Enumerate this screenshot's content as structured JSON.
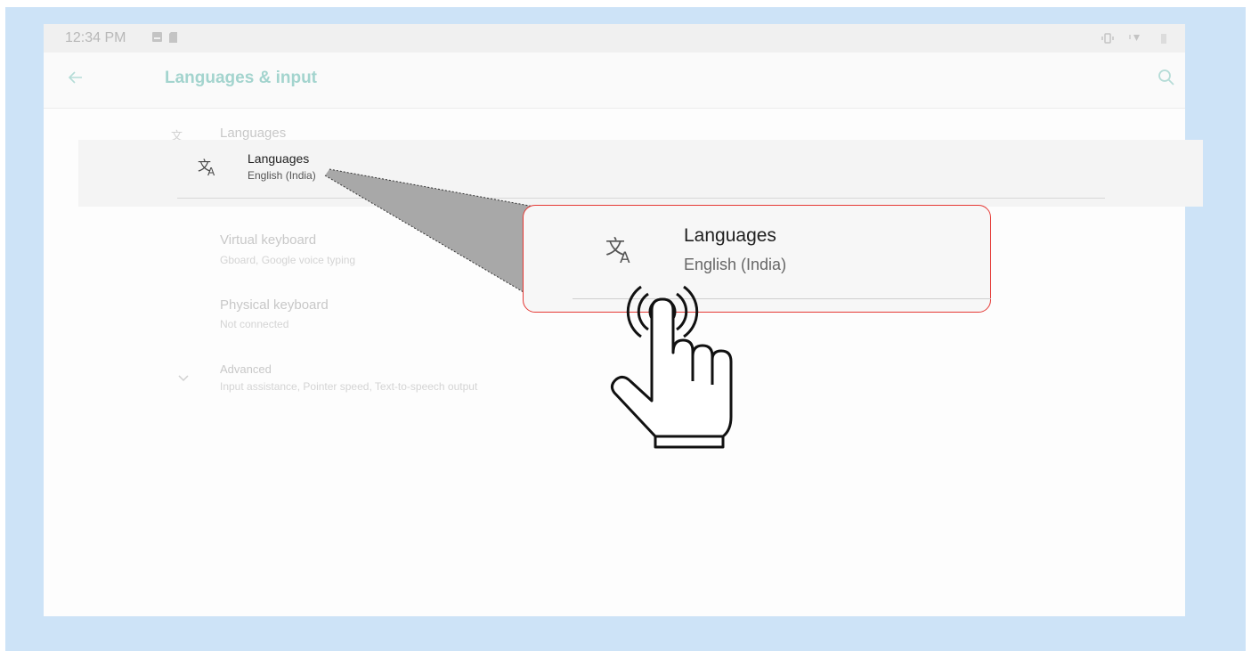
{
  "status_bar": {
    "time": "12:34 PM"
  },
  "toolbar": {
    "title": "Languages & input"
  },
  "list": {
    "languages_header": "Languages",
    "virtual_keyboard": {
      "title": "Virtual keyboard",
      "subtitle": "Gboard, Google voice typing"
    },
    "physical_keyboard": {
      "title": "Physical keyboard",
      "subtitle": "Not connected"
    },
    "advanced": {
      "title": "Advanced",
      "subtitle": "Input assistance, Pointer speed, Text-to-speech output"
    }
  },
  "highlight": {
    "title": "Languages",
    "subtitle": "English (India)"
  },
  "zoom": {
    "title": "Languages",
    "subtitle": "English (India)"
  },
  "colors": {
    "accent": "#a3d4ce",
    "callout_border": "#e53935",
    "frame": "#cde3f7"
  },
  "icons": {
    "translate": "translate-icon",
    "back": "arrow-back-icon",
    "search": "search-icon",
    "tap": "tap-hand-icon"
  }
}
